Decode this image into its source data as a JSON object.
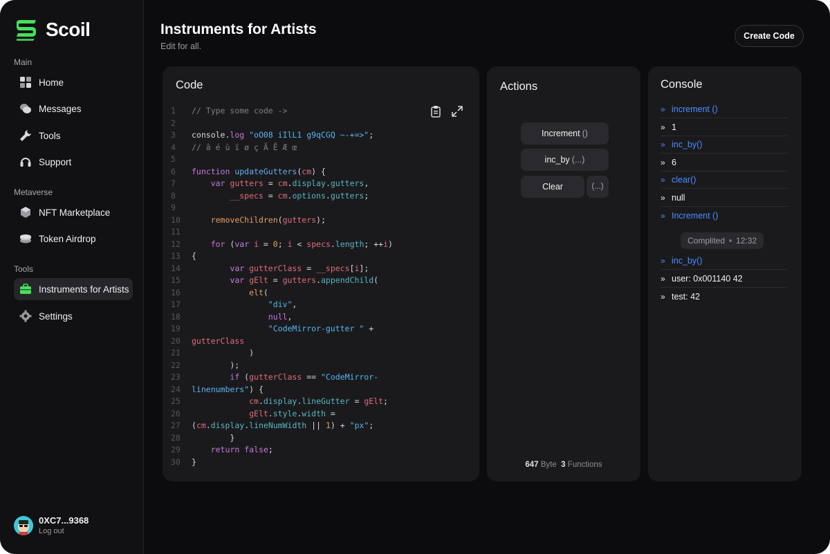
{
  "brand": {
    "name": "Scoil",
    "accent": "#45e05a"
  },
  "sidebar": {
    "sections": [
      {
        "title": "Main",
        "items": [
          {
            "label": "Home",
            "icon": "grid-icon"
          },
          {
            "label": "Messages",
            "icon": "chat-icon"
          },
          {
            "label": "Tools",
            "icon": "wrench-icon"
          },
          {
            "label": "Support",
            "icon": "headset-icon"
          }
        ]
      },
      {
        "title": "Metaverse",
        "items": [
          {
            "label": "NFT Marketplace",
            "icon": "nft-icon"
          },
          {
            "label": "Token Airdrop",
            "icon": "coins-icon"
          }
        ]
      },
      {
        "title": "Tools",
        "items": [
          {
            "label": "Instruments for Artists",
            "icon": "toolbox-icon",
            "active": true
          },
          {
            "label": "Settings",
            "icon": "gear-icon"
          }
        ]
      }
    ],
    "user": {
      "address": "0XC7...9368",
      "logout_label": "Log out"
    }
  },
  "header": {
    "title": "Instruments for Artists",
    "subtitle": "Edit for all.",
    "create_button": "Create Code"
  },
  "code_panel": {
    "title": "Code",
    "tools": [
      "clipboard-icon",
      "expand-icon"
    ],
    "lines": [
      [
        [
          "// Type some code ->",
          "#7d7d85"
        ]
      ],
      [],
      [
        [
          "console",
          "#d9d9dc"
        ],
        [
          ".",
          "#d9d9dc"
        ],
        [
          "log",
          "#c678dd"
        ],
        [
          " ",
          "#d9d9dc"
        ],
        [
          "\"oO08 iIlL1 g9qCGQ ~-+=>\"",
          "#56b6f0"
        ],
        [
          ";",
          "#d9d9dc"
        ]
      ],
      [
        [
          "// â é ù ï ø ç Ã Ē Æ œ",
          "#7d7d85"
        ]
      ],
      [],
      [
        [
          "function",
          "#c678dd"
        ],
        [
          " ",
          "#d9d9dc"
        ],
        [
          "updateGutters",
          "#61afef"
        ],
        [
          "(",
          "#d9d9dc"
        ],
        [
          "cm",
          "#e06c75"
        ],
        [
          ") {",
          "#d9d9dc"
        ]
      ],
      [
        [
          "    ",
          "#d9d9dc"
        ],
        [
          "var",
          "#c678dd"
        ],
        [
          " ",
          "#d9d9dc"
        ],
        [
          "gutters",
          "#e06c75"
        ],
        [
          " = ",
          "#d9d9dc"
        ],
        [
          "cm",
          "#e06c75"
        ],
        [
          ".",
          "#d9d9dc"
        ],
        [
          "display",
          "#56b6c2"
        ],
        [
          ".",
          "#d9d9dc"
        ],
        [
          "gutters",
          "#56b6c2"
        ],
        [
          ",",
          "#d9d9dc"
        ]
      ],
      [
        [
          "        ",
          "#d9d9dc"
        ],
        [
          "__specs",
          "#e06c75"
        ],
        [
          " = ",
          "#d9d9dc"
        ],
        [
          "cm",
          "#e06c75"
        ],
        [
          ".",
          "#d9d9dc"
        ],
        [
          "options",
          "#56b6c2"
        ],
        [
          ".",
          "#d9d9dc"
        ],
        [
          "gutters",
          "#56b6c2"
        ],
        [
          ";",
          "#d9d9dc"
        ]
      ],
      [],
      [
        [
          "    ",
          "#d9d9dc"
        ],
        [
          "removeChildren",
          "#e5a05b"
        ],
        [
          "(",
          "#d9d9dc"
        ],
        [
          "gutters",
          "#e06c75"
        ],
        [
          ");",
          "#d9d9dc"
        ]
      ],
      [],
      [
        [
          "    ",
          "#d9d9dc"
        ],
        [
          "for",
          "#c678dd"
        ],
        [
          " (",
          "#d9d9dc"
        ],
        [
          "var",
          "#c678dd"
        ],
        [
          " ",
          "#d9d9dc"
        ],
        [
          "i",
          "#e06c75"
        ],
        [
          " = ",
          "#d9d9dc"
        ],
        [
          "0",
          "#e5a05b"
        ],
        [
          "; ",
          "#d9d9dc"
        ],
        [
          "i",
          "#e06c75"
        ],
        [
          " < ",
          "#d9d9dc"
        ],
        [
          "specs",
          "#e06c75"
        ],
        [
          ".",
          "#d9d9dc"
        ],
        [
          "length",
          "#56b6c2"
        ],
        [
          "; ++",
          "#d9d9dc"
        ],
        [
          "i",
          "#e06c75"
        ],
        [
          ")",
          "#d9d9dc"
        ]
      ],
      [
        [
          "{",
          "#d9d9dc"
        ]
      ],
      [
        [
          "        ",
          "#d9d9dc"
        ],
        [
          "var",
          "#c678dd"
        ],
        [
          " ",
          "#d9d9dc"
        ],
        [
          "gutterClass",
          "#e06c75"
        ],
        [
          " = ",
          "#d9d9dc"
        ],
        [
          "__specs",
          "#e06c75"
        ],
        [
          "[",
          "#d9d9dc"
        ],
        [
          "i",
          "#e06c75"
        ],
        [
          "];",
          "#d9d9dc"
        ]
      ],
      [
        [
          "        ",
          "#d9d9dc"
        ],
        [
          "var",
          "#c678dd"
        ],
        [
          " ",
          "#d9d9dc"
        ],
        [
          "gElt",
          "#e06c75"
        ],
        [
          " = ",
          "#d9d9dc"
        ],
        [
          "gutters",
          "#e06c75"
        ],
        [
          ".",
          "#d9d9dc"
        ],
        [
          "appendChild",
          "#56b6c2"
        ],
        [
          "(",
          "#d9d9dc"
        ]
      ],
      [
        [
          "            ",
          "#d9d9dc"
        ],
        [
          "elt",
          "#e5a05b"
        ],
        [
          "(",
          "#d9d9dc"
        ]
      ],
      [
        [
          "                ",
          "#d9d9dc"
        ],
        [
          "\"div\"",
          "#56b6f0"
        ],
        [
          ",",
          "#d9d9dc"
        ]
      ],
      [
        [
          "                ",
          "#d9d9dc"
        ],
        [
          "null",
          "#c678dd"
        ],
        [
          ",",
          "#d9d9dc"
        ]
      ],
      [
        [
          "                ",
          "#d9d9dc"
        ],
        [
          "\"CodeMirror-gutter \"",
          "#56b6f0"
        ],
        [
          " +",
          "#d9d9dc"
        ]
      ],
      [
        [
          "gutterClass",
          "#e06c75"
        ]
      ],
      [
        [
          "            )",
          "#d9d9dc"
        ]
      ],
      [
        [
          "        );",
          "#d9d9dc"
        ]
      ],
      [
        [
          "        ",
          "#d9d9dc"
        ],
        [
          "if",
          "#c678dd"
        ],
        [
          " (",
          "#d9d9dc"
        ],
        [
          "gutterClass",
          "#e06c75"
        ],
        [
          " == ",
          "#d9d9dc"
        ],
        [
          "\"CodeMirror-",
          "#56b6f0"
        ]
      ],
      [
        [
          "linenumbers\"",
          "#56b6f0"
        ],
        [
          ") {",
          "#d9d9dc"
        ]
      ],
      [
        [
          "            ",
          "#d9d9dc"
        ],
        [
          "cm",
          "#e06c75"
        ],
        [
          ".",
          "#d9d9dc"
        ],
        [
          "display",
          "#56b6c2"
        ],
        [
          ".",
          "#d9d9dc"
        ],
        [
          "lineGutter",
          "#56b6c2"
        ],
        [
          " = ",
          "#d9d9dc"
        ],
        [
          "gElt",
          "#e06c75"
        ],
        [
          ";",
          "#d9d9dc"
        ]
      ],
      [
        [
          "            ",
          "#d9d9dc"
        ],
        [
          "gElt",
          "#e06c75"
        ],
        [
          ".",
          "#d9d9dc"
        ],
        [
          "style",
          "#56b6c2"
        ],
        [
          ".",
          "#d9d9dc"
        ],
        [
          "width",
          "#56b6c2"
        ],
        [
          " =",
          "#d9d9dc"
        ]
      ],
      [
        [
          "(",
          "#d9d9dc"
        ],
        [
          "cm",
          "#e06c75"
        ],
        [
          ".",
          "#d9d9dc"
        ],
        [
          "display",
          "#56b6c2"
        ],
        [
          ".",
          "#d9d9dc"
        ],
        [
          "lineNumWidth",
          "#56b6c2"
        ],
        [
          " || ",
          "#d9d9dc"
        ],
        [
          "1",
          "#e5a05b"
        ],
        [
          ") + ",
          "#d9d9dc"
        ],
        [
          "\"px\"",
          "#56b6f0"
        ],
        [
          ";",
          "#d9d9dc"
        ]
      ],
      [
        [
          "        }",
          "#d9d9dc"
        ]
      ],
      [
        [
          "    ",
          "#d9d9dc"
        ],
        [
          "return",
          "#c678dd"
        ],
        [
          " ",
          "#d9d9dc"
        ],
        [
          "false",
          "#c678dd"
        ],
        [
          ";",
          "#d9d9dc"
        ]
      ],
      [
        [
          "}",
          "#d9d9dc"
        ]
      ]
    ]
  },
  "actions_panel": {
    "title": "Actions",
    "increment": {
      "label": "Increment",
      "args": "()"
    },
    "inc_by": {
      "label": "inc_by",
      "args": "(...)"
    },
    "clear": {
      "label": "Clear",
      "args": "(...)"
    },
    "stats": {
      "bytes": "647",
      "bytes_unit": "Byte",
      "functions": "3",
      "functions_unit": "Functions"
    }
  },
  "console_panel": {
    "title": "Console",
    "rows": [
      {
        "kind": "call",
        "text": "increment ()"
      },
      {
        "kind": "out",
        "text": "1"
      },
      {
        "kind": "call",
        "text": "inc_by()"
      },
      {
        "kind": "out",
        "text": "6"
      },
      {
        "kind": "call",
        "text": "clear()"
      },
      {
        "kind": "out",
        "text": "null"
      },
      {
        "kind": "call",
        "text": "Increment ()"
      }
    ],
    "completed": {
      "label": "Complited",
      "time": "12:32"
    },
    "rows_after": [
      {
        "kind": "call",
        "text": "inc_by()"
      },
      {
        "kind": "out",
        "text": "user: 0x001140 42"
      },
      {
        "kind": "out",
        "text": "test: 42"
      }
    ],
    "colors": {
      "call": "#4b8dff",
      "out": "#f2f2f4"
    }
  }
}
